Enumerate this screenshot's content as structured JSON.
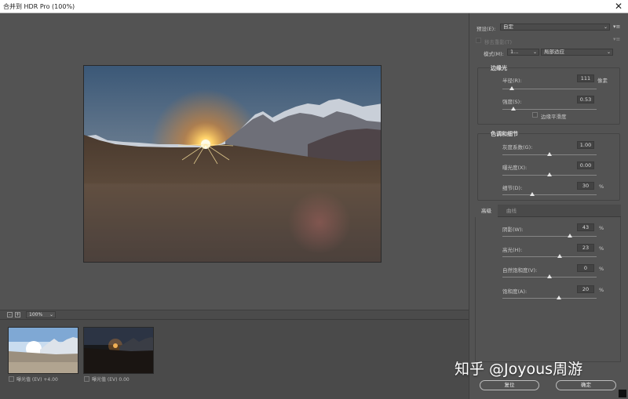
{
  "window": {
    "title": "合并到 HDR Pro (100%)",
    "close_glyph": "✕"
  },
  "zoom": {
    "out": "-",
    "in": "+",
    "value": "100%"
  },
  "filmstrip": [
    {
      "label": "曝光值 (EV) +4.00"
    },
    {
      "label": "曝光值 (EV) 0.00"
    }
  ],
  "panel": {
    "preset_label": "预设(E):",
    "preset_value": "自定",
    "remove_ghost": "移去重影(T)",
    "mode_label": "模式(M):",
    "mode_value": "1...",
    "method_value": "局部适应",
    "edge_glow": {
      "title": "边缘光",
      "radius_label": "半径(R):",
      "radius_value": "111",
      "radius_unit": "像素",
      "radius_pos": 0.1,
      "strength_label": "强度(S):",
      "strength_value": "0.53",
      "strength_pos": 0.12,
      "smooth_label": "边缘平滑度"
    },
    "tone_detail": {
      "title": "色调和细节",
      "gamma_label": "灰度系数(G):",
      "gamma_value": "1.00",
      "gamma_pos": 0.5,
      "exposure_label": "曝光度(X):",
      "exposure_value": "0.00",
      "exposure_pos": 0.5,
      "detail_label": "细节(D):",
      "detail_value": "30",
      "detail_unit": "%",
      "detail_pos": 0.32
    },
    "tabs": {
      "advanced": "高级",
      "curve": "曲线"
    },
    "advanced": {
      "shadow_label": "阴影(W):",
      "shadow_value": "43",
      "shadow_pos": 0.72,
      "highlight_label": "高光(H):",
      "highlight_value": "23",
      "highlight_pos": 0.61,
      "vibrance_label": "自然饱和度(V):",
      "vibrance_value": "0",
      "vibrance_pos": 0.5,
      "saturation_label": "饱和度(A):",
      "saturation_value": "20",
      "saturation_pos": 0.6,
      "percent": "%"
    },
    "reset": "复位",
    "ok": "确定"
  },
  "watermark": "知乎 @Joyous周游"
}
